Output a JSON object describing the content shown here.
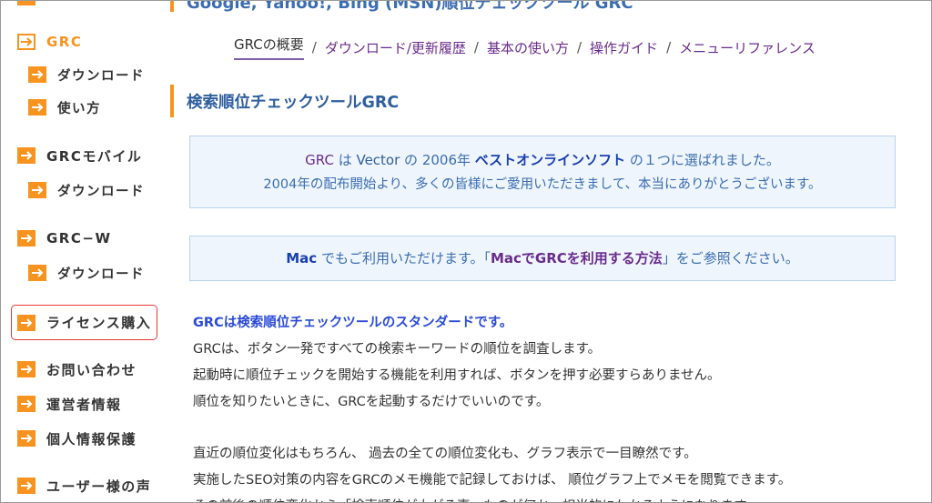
{
  "sidebar": {
    "items": [
      {
        "label": "GRC",
        "level": "top",
        "active": true
      },
      {
        "label": "ダウンロード",
        "level": "sub"
      },
      {
        "label": "使い方",
        "level": "sub"
      },
      {
        "label": "GRCモバイル",
        "level": "top"
      },
      {
        "label": "ダウンロード",
        "level": "sub"
      },
      {
        "label": "GRC−W",
        "level": "top"
      },
      {
        "label": "ダウンロード",
        "level": "sub"
      },
      {
        "label": "ライセンス購入",
        "level": "top",
        "highlighted": true
      },
      {
        "label": "お問い合わせ",
        "level": "top"
      },
      {
        "label": "運営者情報",
        "level": "top"
      },
      {
        "label": "個人情報保護",
        "level": "top"
      },
      {
        "label": "ユーザー様の声",
        "level": "top"
      }
    ]
  },
  "header": {
    "cut_title": "Google, Yahoo!, Bing (MSN)順位チェックツール GRC"
  },
  "breadcrumb": {
    "items": [
      "GRCの概要",
      "ダウンロード/更新履歴",
      "基本の使い方",
      "操作ガイド",
      "メニューリファレンス"
    ],
    "separator": "/"
  },
  "section": {
    "title": "検索順位チェックツールGRC"
  },
  "notice1": {
    "p1": "GRC",
    "p2": " は ",
    "p3": "Vector",
    "p4": " の 2006年 ",
    "p5": "ベストオンラインソフト",
    "p6": " の１つに選ばれました。",
    "line2": "2004年の配布開始より、多くの皆様にご愛用いただきまして、本当にありがとうございます。"
  },
  "notice2": {
    "mac": "Mac",
    "text1": " でもご利用いただけます。「",
    "link": "MacでGRCを利用する方法",
    "text2": "」をご参照ください。"
  },
  "content": {
    "lead": "GRCは検索順位チェックツールのスタンダードです。",
    "lines": [
      "GRCは、ボタン一発ですべての検索キーワードの順位を調査します。",
      "起動時に順位チェックを開始する機能を利用すれば、ボタンを押す必要すらありません。",
      "順位を知りたいときに、GRCを起動するだけでいいのです。"
    ],
    "lines2": [
      "直近の順位変化はもちろん、 過去の全ての順位変化も、グラフ表示で一目瞭然です。",
      "実施したSEO対策の内容をGRCのメモ機能で記録しておけば、 順位グラフ上でメモを閲覧できます。",
      "その前後の順位変化から「検索順位が上がる事」ものが何か、相当的にわかるようになります。"
    ]
  },
  "colors": {
    "accent": "#f7931e",
    "link": "#6a2c8c",
    "heading": "#2e5f9e",
    "lead": "#2b4bd6"
  }
}
